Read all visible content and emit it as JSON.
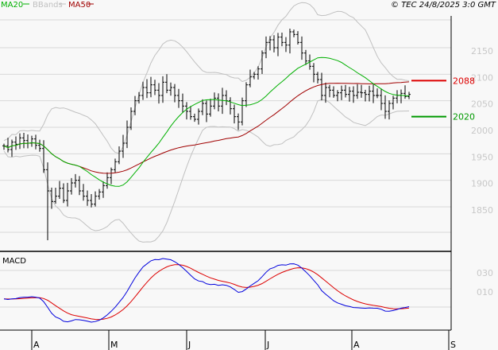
{
  "chart_data": {
    "type": "ohlc",
    "title": "",
    "copyright": "© TEC 24/8/2025 3:0 GMT",
    "legend": [
      {
        "label": "MA20",
        "color": "#00b000"
      },
      {
        "label": "BBands",
        "color": "#c0c0c0"
      },
      {
        "label": "MA50",
        "color": "#a00000"
      }
    ],
    "price_axis": {
      "ticks": [
        "2150",
        "2100",
        "2050",
        "2000",
        "1950",
        "1900",
        "1850"
      ],
      "ylim": [
        1790,
        2195
      ]
    },
    "markers": [
      {
        "label": "2088",
        "value": 2088,
        "color": "#dd0000"
      },
      {
        "label": "2020",
        "value": 2020,
        "color": "#009900"
      }
    ],
    "x_labels": [
      "A",
      "M",
      "J",
      "J",
      "A",
      "S"
    ],
    "macd_panel": {
      "title": "MACD",
      "ticks": [
        "030",
        "010"
      ],
      "macd_color": "#0000dd",
      "signal_color": "#dd0000"
    },
    "close": [
      1965,
      1958,
      1972,
      1968,
      1980,
      1975,
      1970,
      1978,
      1966,
      1960,
      1920,
      1880,
      1860,
      1870,
      1885,
      1862,
      1880,
      1895,
      1900,
      1880,
      1870,
      1862,
      1855,
      1870,
      1878,
      1890,
      1905,
      1920,
      1935,
      1955,
      1970,
      2000,
      2030,
      2050,
      2060,
      2075,
      2065,
      2080,
      2070,
      2060,
      2085,
      2070,
      2075,
      2060,
      2050,
      2040,
      2030,
      2020,
      2015,
      2030,
      2045,
      2025,
      2040,
      2055,
      2040,
      2060,
      2050,
      2035,
      2020,
      2010,
      2050,
      2080,
      2095,
      2100,
      2110,
      2140,
      2160,
      2165,
      2150,
      2170,
      2160,
      2155,
      2180,
      2175,
      2160,
      2140,
      2125,
      2115,
      2100,
      2090,
      2060,
      2075,
      2070,
      2060,
      2065,
      2070,
      2062,
      2068,
      2060,
      2066,
      2065,
      2062,
      2068,
      2060,
      2060,
      2045,
      2030,
      2045,
      2055,
      2060,
      2064,
      2058,
      2062
    ],
    "spikes": [
      {
        "index": 11,
        "low": 1787
      }
    ]
  }
}
